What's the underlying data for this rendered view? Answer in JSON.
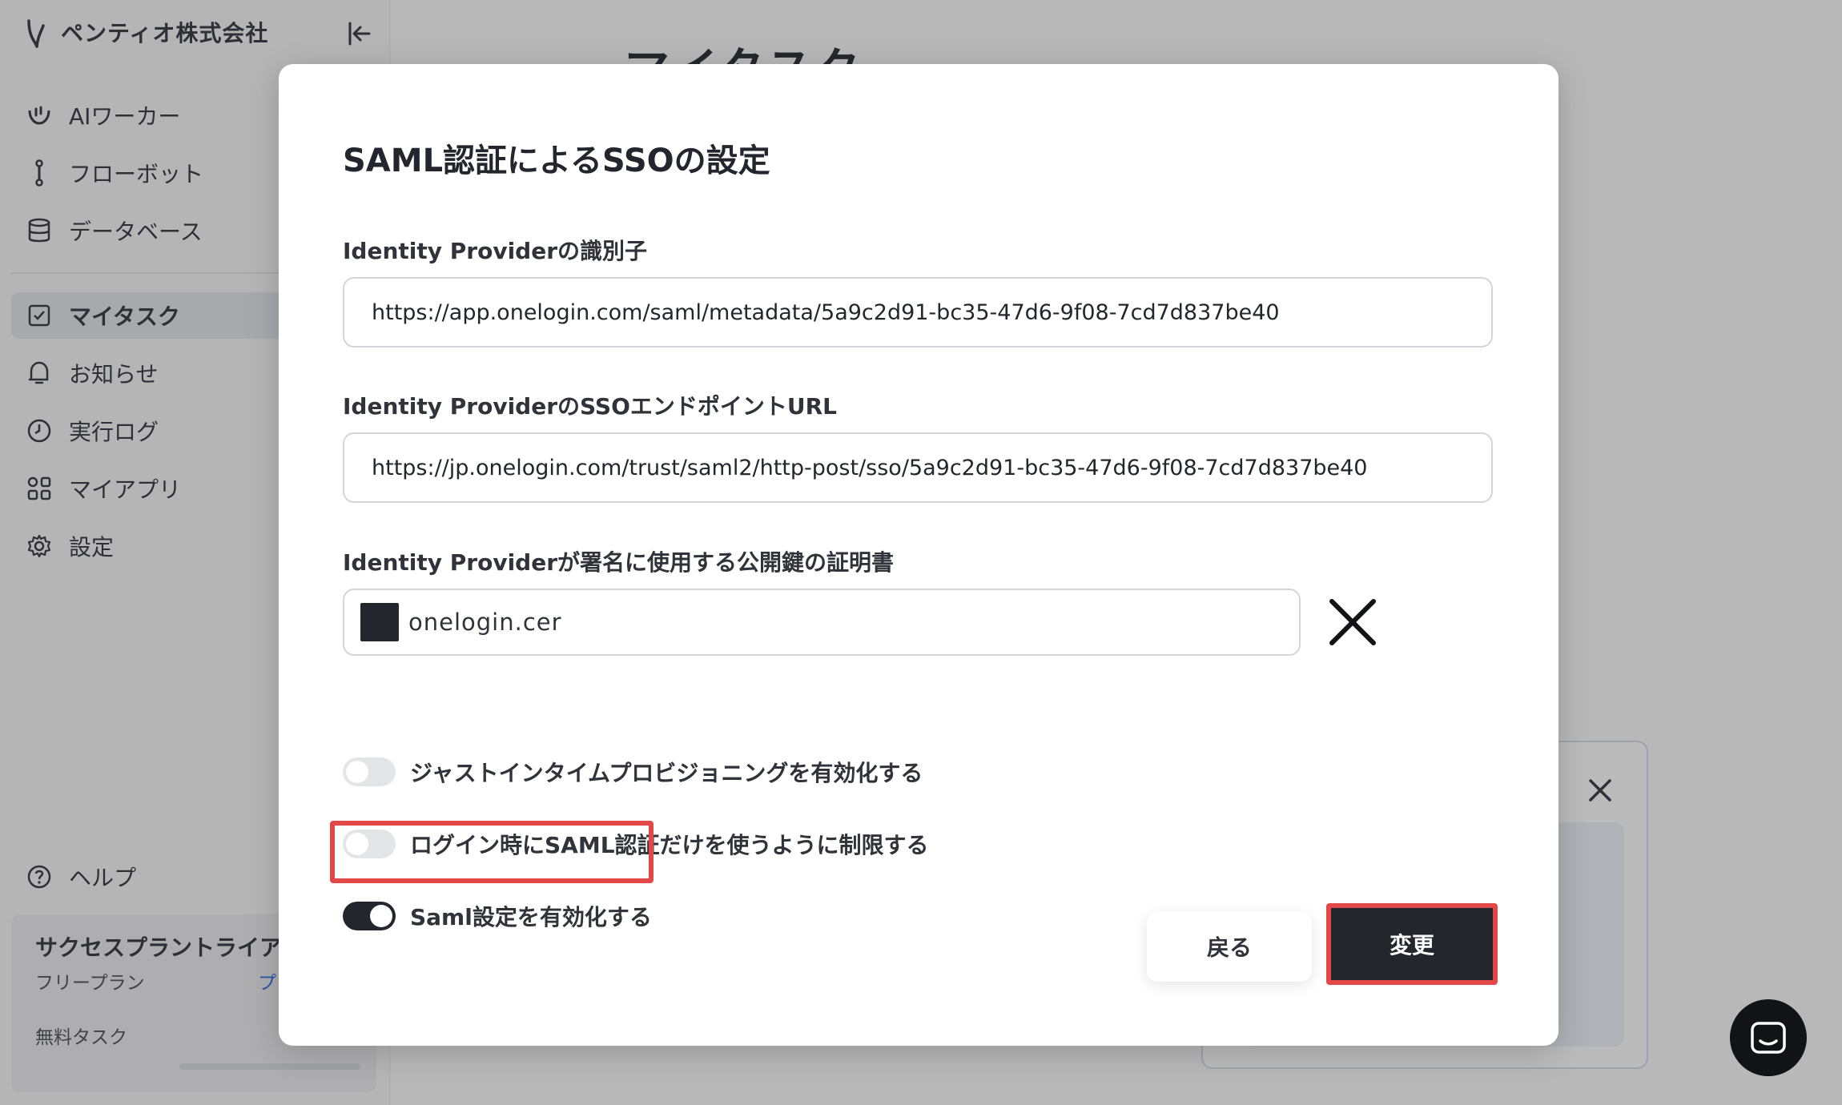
{
  "brand": {
    "name": "ペンティオ株式会社"
  },
  "sidebar": {
    "items": [
      {
        "label": "AIワーカー",
        "icon": "ai-worker-icon"
      },
      {
        "label": "フローボット",
        "icon": "flowbot-icon"
      },
      {
        "label": "データベース",
        "icon": "database-icon"
      },
      {
        "label": "マイタスク",
        "icon": "checkbox-icon",
        "active": true
      },
      {
        "label": "お知らせ",
        "icon": "bell-icon"
      },
      {
        "label": "実行ログ",
        "icon": "clock-icon"
      },
      {
        "label": "マイアプリ",
        "icon": "apps-icon"
      },
      {
        "label": "設定",
        "icon": "gear-icon"
      }
    ],
    "help_label": "ヘルプ",
    "trial": {
      "title": "サクセスプラントライアル",
      "plan": "フリープラン",
      "plan_link": "プ",
      "free_tasks": "無料タスク"
    }
  },
  "main": {
    "title": "マイタスク"
  },
  "modal": {
    "title": "SAML認証によるSSOの設定",
    "idp_identifier": {
      "label": "Identity Providerの識別子",
      "value": "https://app.onelogin.com/saml/metadata/5a9c2d91-bc35-47d6-9f08-7cd7d837be40"
    },
    "sso_url": {
      "label": "Identity ProviderのSSOエンドポイントURL",
      "value": "https://jp.onelogin.com/trust/saml2/http-post/sso/5a9c2d91-bc35-47d6-9f08-7cd7d837be40"
    },
    "certificate": {
      "label": "Identity Providerが署名に使用する公開鍵の証明書",
      "file_name": "onelogin.cer"
    },
    "toggles": [
      {
        "label": "ジャストインタイムプロビジョニングを有効化する",
        "on": false
      },
      {
        "label": "ログイン時にSAML認証だけを使うように制限する",
        "on": false
      },
      {
        "label": "Saml設定を有効化する",
        "on": true
      }
    ],
    "back_label": "戻る",
    "submit_label": "変更"
  },
  "colors": {
    "accent_dark": "#23262d",
    "highlight_red": "#e34848",
    "overlay": "rgba(45,45,45,0.32)"
  }
}
